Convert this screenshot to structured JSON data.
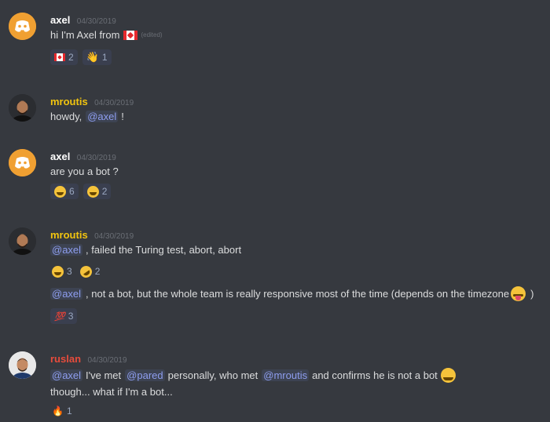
{
  "colors": {
    "background": "#36393f",
    "axel": "#ffffff",
    "mroutis": "#f1c40f",
    "ruslan": "#e74c3c",
    "mention": "#8e9ef0"
  },
  "messages": [
    {
      "author": "axel",
      "timestamp": "04/30/2019",
      "avatar_icon": "discord-logo-icon",
      "lines": [
        {
          "text": "hi I'm Axel from",
          "emoji": "canada-flag-icon",
          "edited": "(edited)"
        }
      ],
      "reactions": [
        {
          "emoji": "canada-flag-icon",
          "count": "2"
        },
        {
          "emoji": "waving-hand-icon",
          "count": "1"
        }
      ]
    },
    {
      "author": "mroutis",
      "timestamp": "04/30/2019",
      "avatar_icon": "user-photo-icon",
      "lines": [
        {
          "pre": "howdy,",
          "mention": "@axel",
          "post": "!"
        }
      ]
    },
    {
      "author": "axel",
      "timestamp": "04/30/2019",
      "avatar_icon": "discord-logo-icon",
      "lines": [
        {
          "text": "are you a bot ?"
        }
      ],
      "reactions": [
        {
          "emoji": "grinning-face-icon",
          "count": "6"
        },
        {
          "emoji": "tears-of-joy-icon",
          "count": "2"
        }
      ]
    },
    {
      "author": "mroutis",
      "timestamp": "04/30/2019",
      "avatar_icon": "user-photo-icon",
      "lines": [
        {
          "mention": "@axel",
          "post": ", failed the Turing test, abort, abort"
        },
        {
          "mention": "@axel",
          "post": ", not a bot, but the whole team is really responsive most of the time (depends on the timezone",
          "emoji": "tongue-face-icon",
          "post2": ")"
        }
      ],
      "reactions": [
        {
          "emoji": "grinning-face-icon",
          "count": "3"
        },
        {
          "emoji": "rolling-laughing-icon",
          "count": "2"
        }
      ],
      "reactions2": [
        {
          "emoji": "hundred-points-icon",
          "count": "3"
        }
      ]
    },
    {
      "author": "ruslan",
      "timestamp": "04/30/2019",
      "avatar_icon": "user-photo-icon",
      "lines": [
        {
          "mention": "@axel",
          "post": "I've met",
          "mention2": "@pared",
          "post2": "personally, who met",
          "mention3": "@mroutis",
          "post3": "and confirms he is not a bot",
          "emoji": "grinning-face-icon"
        },
        {
          "text": "though... what if I'm a bot..."
        }
      ],
      "reactions": [
        {
          "emoji": "fire-icon",
          "count": "1"
        }
      ]
    }
  ]
}
